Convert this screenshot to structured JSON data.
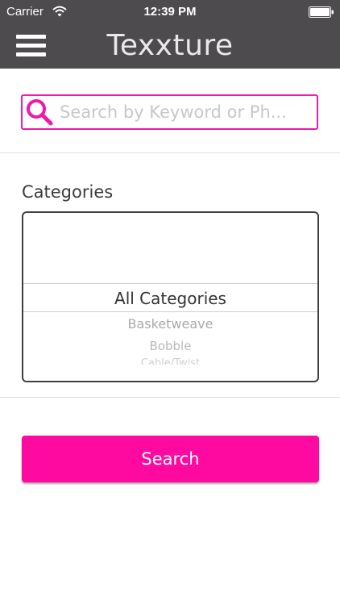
{
  "status_bar": {
    "carrier": "Carrier",
    "time": "12:39 PM",
    "wifi_icon": "wifi-icon",
    "battery_icon": "battery-icon"
  },
  "nav": {
    "title": "Texxture",
    "menu_icon": "hamburger-menu-icon",
    "background_color": "#4e4b4e"
  },
  "search": {
    "placeholder": "Search by Keyword or Ph...",
    "value": "",
    "icon": "search-icon",
    "accent_color": "#ef1aa5"
  },
  "categories": {
    "label": "Categories",
    "selected": "All Categories",
    "options": [
      "Basketweave",
      "Bobble",
      "Cable/Twist"
    ]
  },
  "search_button": {
    "label": "Search",
    "color": "#ff0aa0"
  }
}
